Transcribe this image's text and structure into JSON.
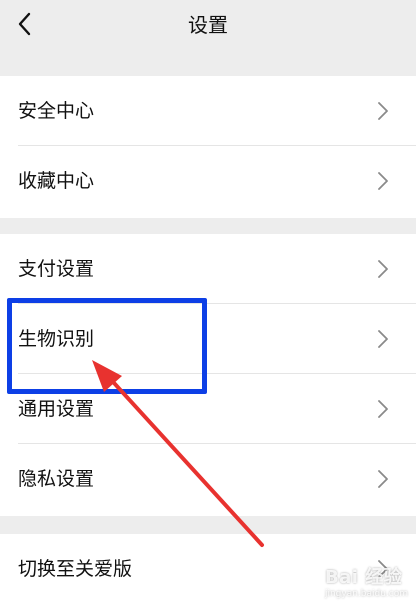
{
  "header": {
    "title": "设置",
    "back_icon": "chevron-left-icon"
  },
  "groups": [
    {
      "items": [
        {
          "label": "安全中心"
        },
        {
          "label": "收藏中心"
        }
      ]
    },
    {
      "items": [
        {
          "label": "支付设置"
        },
        {
          "label": "生物识别",
          "highlighted": true
        },
        {
          "label": "通用设置"
        },
        {
          "label": "隐私设置"
        }
      ]
    },
    {
      "items": [
        {
          "label": "切换至关爱版"
        }
      ]
    }
  ],
  "row_chevron_icon": "chevron-right-icon",
  "annotation": {
    "box_color": "#0d3fe6",
    "arrow_color": "#e8322f"
  },
  "watermark": {
    "text": "Bai 经验",
    "subtext": "jingyan.baidu.com"
  }
}
